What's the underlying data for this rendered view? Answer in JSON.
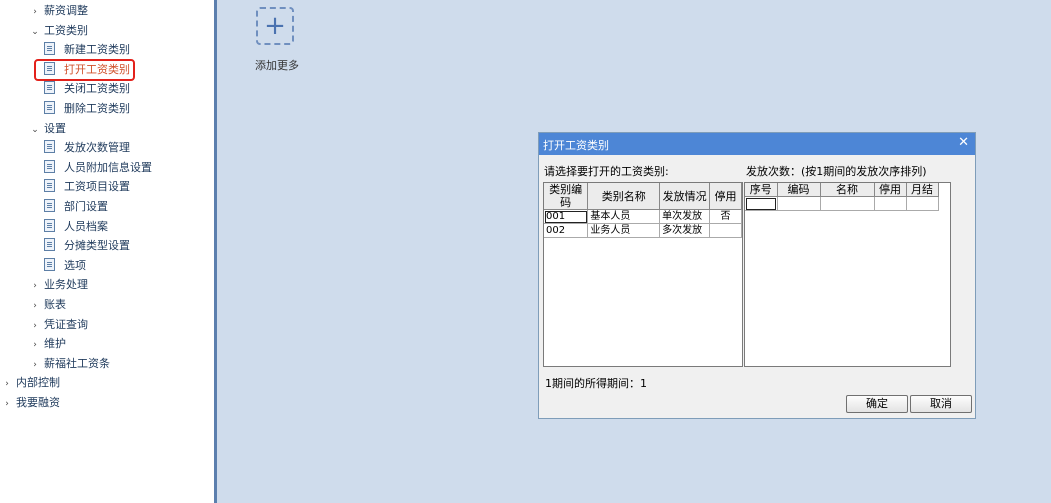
{
  "sidebar": {
    "items": [
      {
        "label": "薪资调整",
        "kind": "folder",
        "state": "collapsed"
      },
      {
        "label": "工资类别",
        "kind": "folder",
        "state": "expanded"
      },
      {
        "label": "新建工资类别",
        "kind": "leaf"
      },
      {
        "label": "打开工资类别",
        "kind": "leaf",
        "active": true
      },
      {
        "label": "关闭工资类别",
        "kind": "leaf"
      },
      {
        "label": "删除工资类别",
        "kind": "leaf"
      },
      {
        "label": "设置",
        "kind": "folder",
        "state": "expanded"
      },
      {
        "label": "发放次数管理",
        "kind": "leaf"
      },
      {
        "label": "人员附加信息设置",
        "kind": "leaf"
      },
      {
        "label": "工资项目设置",
        "kind": "leaf"
      },
      {
        "label": "部门设置",
        "kind": "leaf"
      },
      {
        "label": "人员档案",
        "kind": "leaf"
      },
      {
        "label": "分摊类型设置",
        "kind": "leaf"
      },
      {
        "label": "选项",
        "kind": "leaf"
      },
      {
        "label": "业务处理",
        "kind": "folder",
        "state": "collapsed"
      },
      {
        "label": "账表",
        "kind": "folder",
        "state": "collapsed"
      },
      {
        "label": "凭证查询",
        "kind": "folder",
        "state": "collapsed"
      },
      {
        "label": "维护",
        "kind": "folder",
        "state": "collapsed"
      },
      {
        "label": "薪福社工资条",
        "kind": "folder",
        "state": "collapsed"
      },
      {
        "label": "内部控制",
        "kind": "root",
        "state": "collapsed"
      },
      {
        "label": "我要融资",
        "kind": "root",
        "state": "collapsed"
      }
    ]
  },
  "main": {
    "add_more_label": "添加更多"
  },
  "dialog": {
    "title": "打开工资类别",
    "left_label": "请选择要打开的工资类别:",
    "right_label": "发放次数：(按1期间的发放次序排列)",
    "left_table": {
      "columns": [
        "类别编码",
        "类别名称",
        "发放情况",
        "停用"
      ],
      "rows": [
        [
          "001",
          "基本人员",
          "单次发放",
          "否"
        ],
        [
          "002",
          "业务人员",
          "多次发放",
          ""
        ]
      ]
    },
    "right_table": {
      "columns": [
        "序号",
        "编码",
        "名称",
        "停用",
        "月结"
      ]
    },
    "period_info": "1期间的所得期间：1",
    "ok_label": "确定",
    "cancel_label": "取消"
  },
  "colors": {
    "titlebar": "#4d86d6",
    "active_item": "#d0502b",
    "highlight_border": "#e3211b",
    "background": "#cfdcec"
  }
}
